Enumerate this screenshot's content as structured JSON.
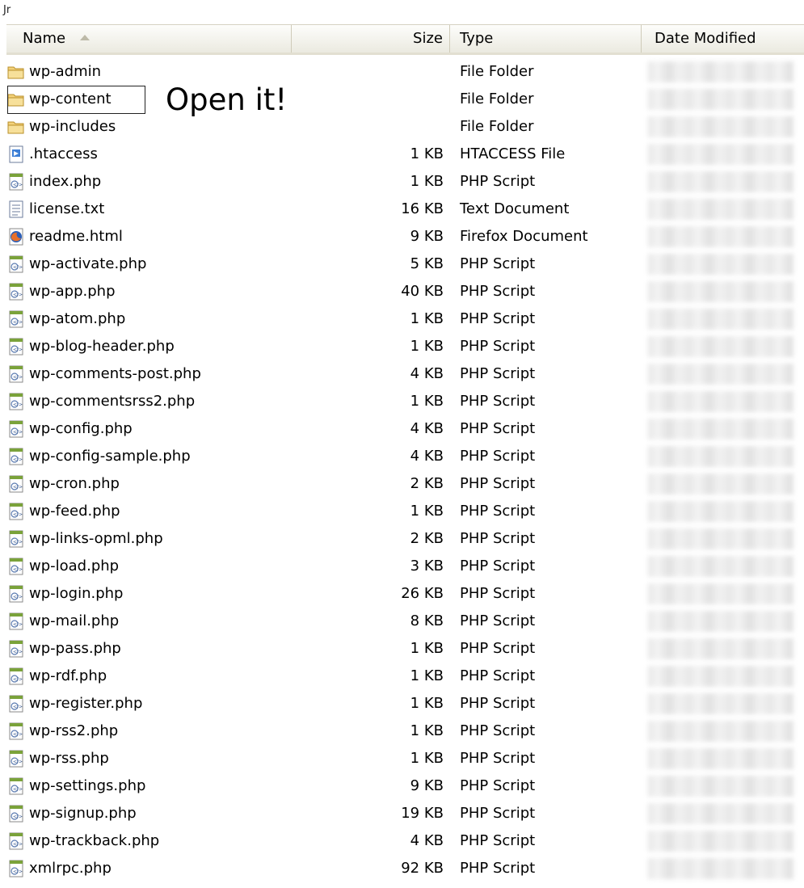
{
  "top_fragment": "Jr",
  "header": {
    "name": "Name",
    "size": "Size",
    "type": "Type",
    "date": "Date Modified"
  },
  "callout": "Open it!",
  "files": [
    {
      "name": "wp-admin",
      "size": "",
      "type": "File Folder",
      "icon": "folder-icon"
    },
    {
      "name": "wp-content",
      "size": "",
      "type": "File Folder",
      "icon": "folder-icon",
      "highlighted": true
    },
    {
      "name": "wp-includes",
      "size": "",
      "type": "File Folder",
      "icon": "folder-icon"
    },
    {
      "name": ".htaccess",
      "size": "1 KB",
      "type": "HTACCESS File",
      "icon": "htaccess-file-icon"
    },
    {
      "name": "index.php",
      "size": "1 KB",
      "type": "PHP Script",
      "icon": "php-script-icon"
    },
    {
      "name": "license.txt",
      "size": "16 KB",
      "type": "Text Document",
      "icon": "text-document-icon"
    },
    {
      "name": "readme.html",
      "size": "9 KB",
      "type": "Firefox Document",
      "icon": "firefox-document-icon"
    },
    {
      "name": "wp-activate.php",
      "size": "5 KB",
      "type": "PHP Script",
      "icon": "php-script-icon"
    },
    {
      "name": "wp-app.php",
      "size": "40 KB",
      "type": "PHP Script",
      "icon": "php-script-icon"
    },
    {
      "name": "wp-atom.php",
      "size": "1 KB",
      "type": "PHP Script",
      "icon": "php-script-icon"
    },
    {
      "name": "wp-blog-header.php",
      "size": "1 KB",
      "type": "PHP Script",
      "icon": "php-script-icon"
    },
    {
      "name": "wp-comments-post.php",
      "size": "4 KB",
      "type": "PHP Script",
      "icon": "php-script-icon"
    },
    {
      "name": "wp-commentsrss2.php",
      "size": "1 KB",
      "type": "PHP Script",
      "icon": "php-script-icon"
    },
    {
      "name": "wp-config.php",
      "size": "4 KB",
      "type": "PHP Script",
      "icon": "php-script-icon"
    },
    {
      "name": "wp-config-sample.php",
      "size": "4 KB",
      "type": "PHP Script",
      "icon": "php-script-icon"
    },
    {
      "name": "wp-cron.php",
      "size": "2 KB",
      "type": "PHP Script",
      "icon": "php-script-icon"
    },
    {
      "name": "wp-feed.php",
      "size": "1 KB",
      "type": "PHP Script",
      "icon": "php-script-icon"
    },
    {
      "name": "wp-links-opml.php",
      "size": "2 KB",
      "type": "PHP Script",
      "icon": "php-script-icon"
    },
    {
      "name": "wp-load.php",
      "size": "3 KB",
      "type": "PHP Script",
      "icon": "php-script-icon"
    },
    {
      "name": "wp-login.php",
      "size": "26 KB",
      "type": "PHP Script",
      "icon": "php-script-icon"
    },
    {
      "name": "wp-mail.php",
      "size": "8 KB",
      "type": "PHP Script",
      "icon": "php-script-icon"
    },
    {
      "name": "wp-pass.php",
      "size": "1 KB",
      "type": "PHP Script",
      "icon": "php-script-icon"
    },
    {
      "name": "wp-rdf.php",
      "size": "1 KB",
      "type": "PHP Script",
      "icon": "php-script-icon"
    },
    {
      "name": "wp-register.php",
      "size": "1 KB",
      "type": "PHP Script",
      "icon": "php-script-icon"
    },
    {
      "name": "wp-rss2.php",
      "size": "1 KB",
      "type": "PHP Script",
      "icon": "php-script-icon"
    },
    {
      "name": "wp-rss.php",
      "size": "1 KB",
      "type": "PHP Script",
      "icon": "php-script-icon"
    },
    {
      "name": "wp-settings.php",
      "size": "9 KB",
      "type": "PHP Script",
      "icon": "php-script-icon"
    },
    {
      "name": "wp-signup.php",
      "size": "19 KB",
      "type": "PHP Script",
      "icon": "php-script-icon"
    },
    {
      "name": "wp-trackback.php",
      "size": "4 KB",
      "type": "PHP Script",
      "icon": "php-script-icon"
    },
    {
      "name": "xmlrpc.php",
      "size": "92 KB",
      "type": "PHP Script",
      "icon": "php-script-icon"
    }
  ]
}
